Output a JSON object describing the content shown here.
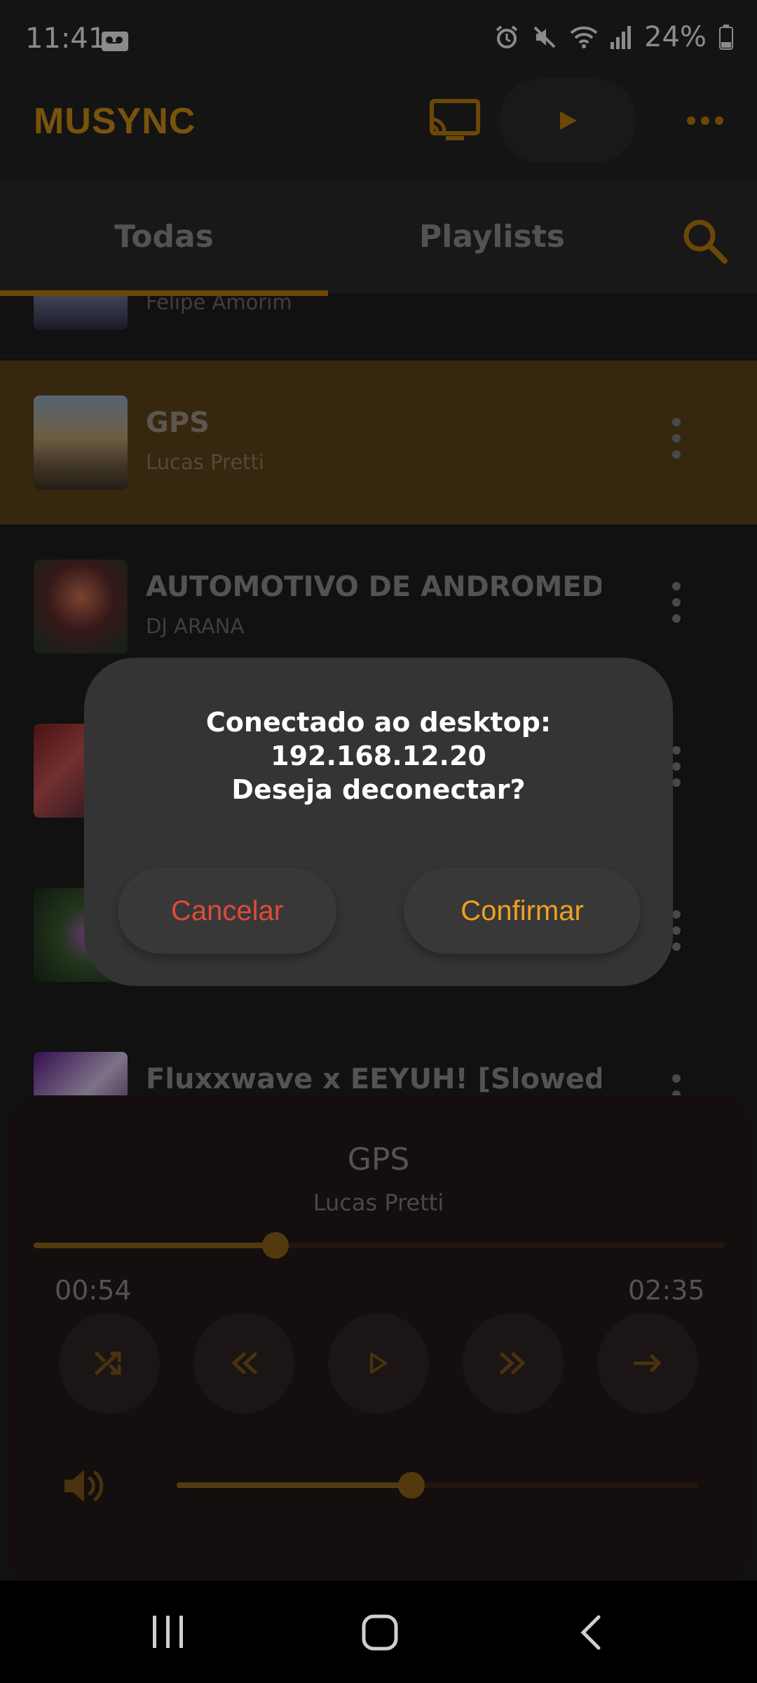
{
  "status_bar": {
    "time": "11:41",
    "battery": "24%",
    "icons": [
      "voicemail-icon",
      "alarm-icon",
      "mute-icon",
      "wifi-icon",
      "signal-icon",
      "battery-icon"
    ]
  },
  "app_bar": {
    "title": "MUSYNC",
    "actions": [
      "cast-icon",
      "play-icon",
      "more-horizontal-icon"
    ]
  },
  "tabs": {
    "items": [
      "Todas",
      "Playlists"
    ],
    "selected": "Todas",
    "search_icon": "search-icon"
  },
  "songs": [
    {
      "title": "",
      "artist": "Felipe Amorim"
    },
    {
      "title": "GPS",
      "artist": "Lucas Pretti",
      "active": true
    },
    {
      "title": "AUTOMOTIVO DE ANDROMEDA",
      "artist": "DJ ARANA"
    },
    {
      "title": "",
      "artist": ""
    },
    {
      "title": "",
      "artist": ""
    },
    {
      "title": "Fluxxwave x EEYUH! [Slowed,",
      "artist": ""
    }
  ],
  "player": {
    "title": "GPS",
    "artist": "Lucas Pretti",
    "current_time": "00:54",
    "total_time": "02:35",
    "progress": 0.35,
    "volume": 0.45,
    "controls": [
      "shuffle-icon",
      "rewind-icon",
      "play-icon",
      "fast-forward-icon",
      "repeat-arrow-icon"
    ],
    "volume_icon": "volume-icon"
  },
  "dialog": {
    "line1": "Conectado ao desktop:",
    "line2": "192.168.12.20",
    "line3": "Deseja deconectar?",
    "cancel": "Cancelar",
    "confirm": "Confirmar"
  },
  "colors": {
    "accent": "#c88a14",
    "cancel": "#e04a3a",
    "confirm": "#f0a020",
    "active_row": "#5a4218"
  }
}
